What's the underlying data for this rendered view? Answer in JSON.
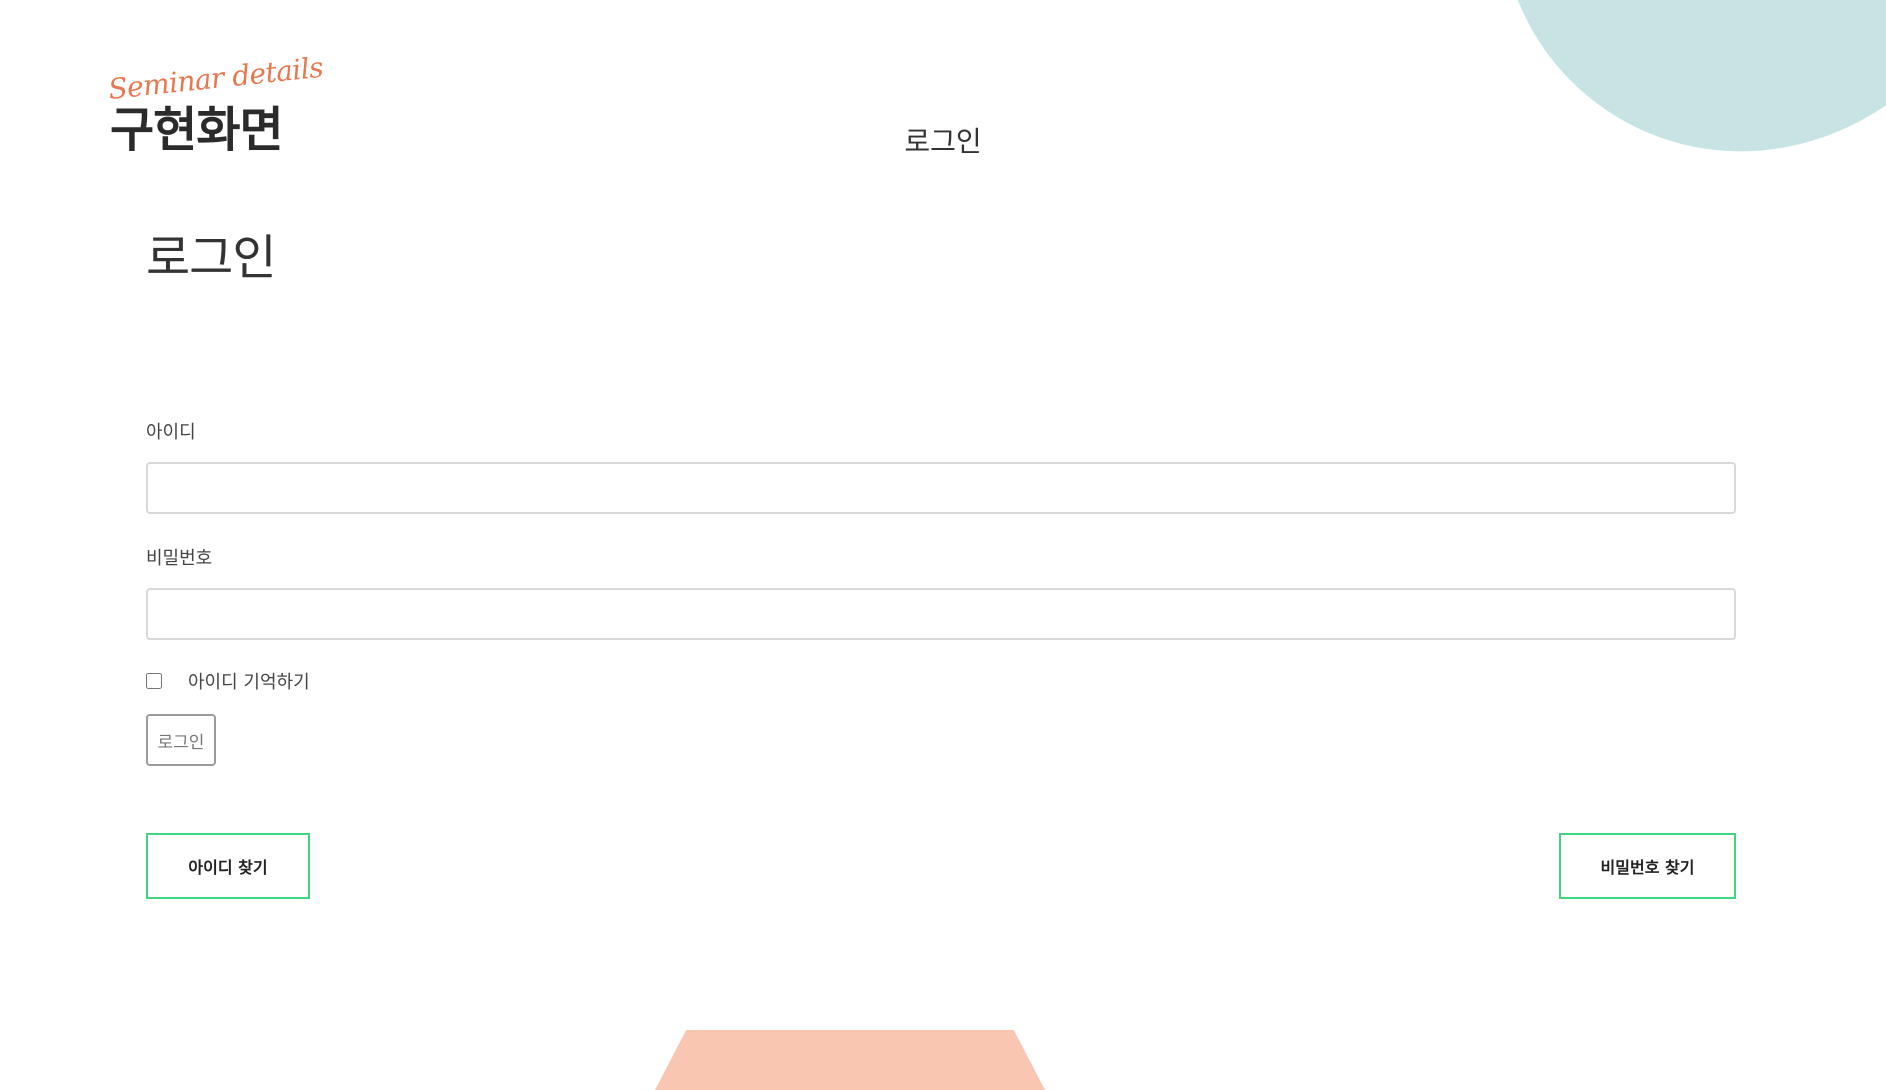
{
  "brand": {
    "script": "Seminar details",
    "title": "구현화면"
  },
  "header": {
    "title": "로그인"
  },
  "main": {
    "heading": "로그인",
    "username_label": "아이디",
    "username_value": "",
    "password_label": "비밀번호",
    "password_value": "",
    "remember_label": "아이디 기억하기",
    "remember_checked": false,
    "login_button": "로그인",
    "find_id_button": "아이디 찾기",
    "find_password_button": "비밀번호 찾기"
  },
  "colors": {
    "accent_green": "#3fd67f",
    "deco_teal": "#c7e3e3",
    "deco_peach": "#f9c6b2",
    "brand_orange": "#e8774e"
  }
}
